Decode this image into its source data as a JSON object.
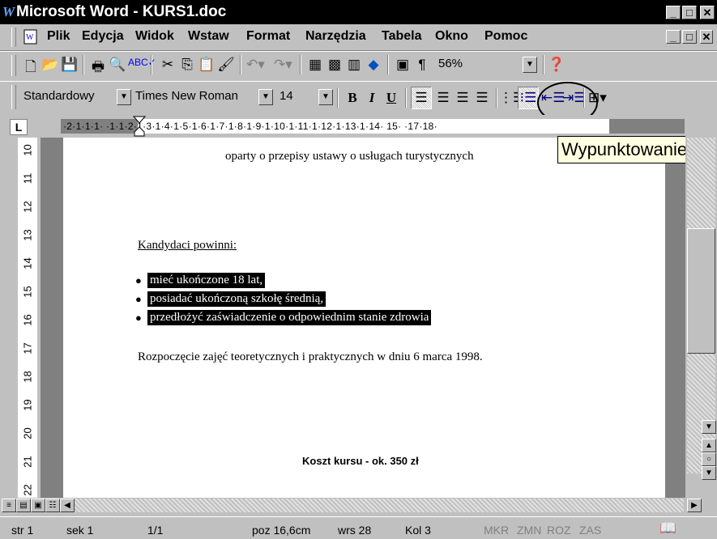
{
  "window": {
    "title": "Microsoft Word - KURS1.doc",
    "app_icon": "W",
    "min": "_",
    "max": "□",
    "close": "✕"
  },
  "menu": {
    "items": [
      "Plik",
      "Edycja",
      "Widok",
      "Wstaw",
      "Format",
      "Narzędzia",
      "Tabela",
      "Okno",
      "Pomoc"
    ],
    "doc_min": "_",
    "doc_max": "□",
    "doc_close": "✕"
  },
  "standard_toolbar": {
    "zoom": "56%",
    "pilcrow": "¶"
  },
  "formatting_toolbar": {
    "style": "Standardowy",
    "font": "Times New Roman",
    "size": "14",
    "bold": "B",
    "italic": "I",
    "underline": "U"
  },
  "ruler": {
    "tab_selector": "L",
    "ticks": "·2·1·1·1·  ·1·1·2·1·3·1·4·1·5·1·6·1·7·1·8·1·9·1·10·1·11·1·12·1·13·1·14·  15·      ·17·18·",
    "vertical": [
      "10",
      "11",
      "12",
      "13",
      "14",
      "15",
      "16",
      "17",
      "18",
      "19",
      "20",
      "21",
      "22"
    ]
  },
  "document": {
    "line1": "oparty o przepisy ustawy o usługach turystycznych",
    "heading": "Kandydaci powinni:",
    "bullets": [
      "mieć ukończone 18 lat,",
      "posiadać ukończoną szkołę średnią,",
      "przedłożyć zaświadczenie o odpowiednim stanie zdrowia"
    ],
    "paragraph": "Rozpoczęcie zajęć teoretycznych i praktycznych w dniu 6 marca 1998.",
    "cost": "Koszt kursu - ok. 350 zł"
  },
  "tooltip": "Wypunktowanie",
  "status": {
    "page": "str 1",
    "section": "sek 1",
    "pages": "1/1",
    "position": "poz 16,6cm",
    "line": "wrs 28",
    "column": "Kol 3",
    "modes": [
      "MKR",
      "ZMN",
      "ROZ",
      "ZAS"
    ]
  }
}
